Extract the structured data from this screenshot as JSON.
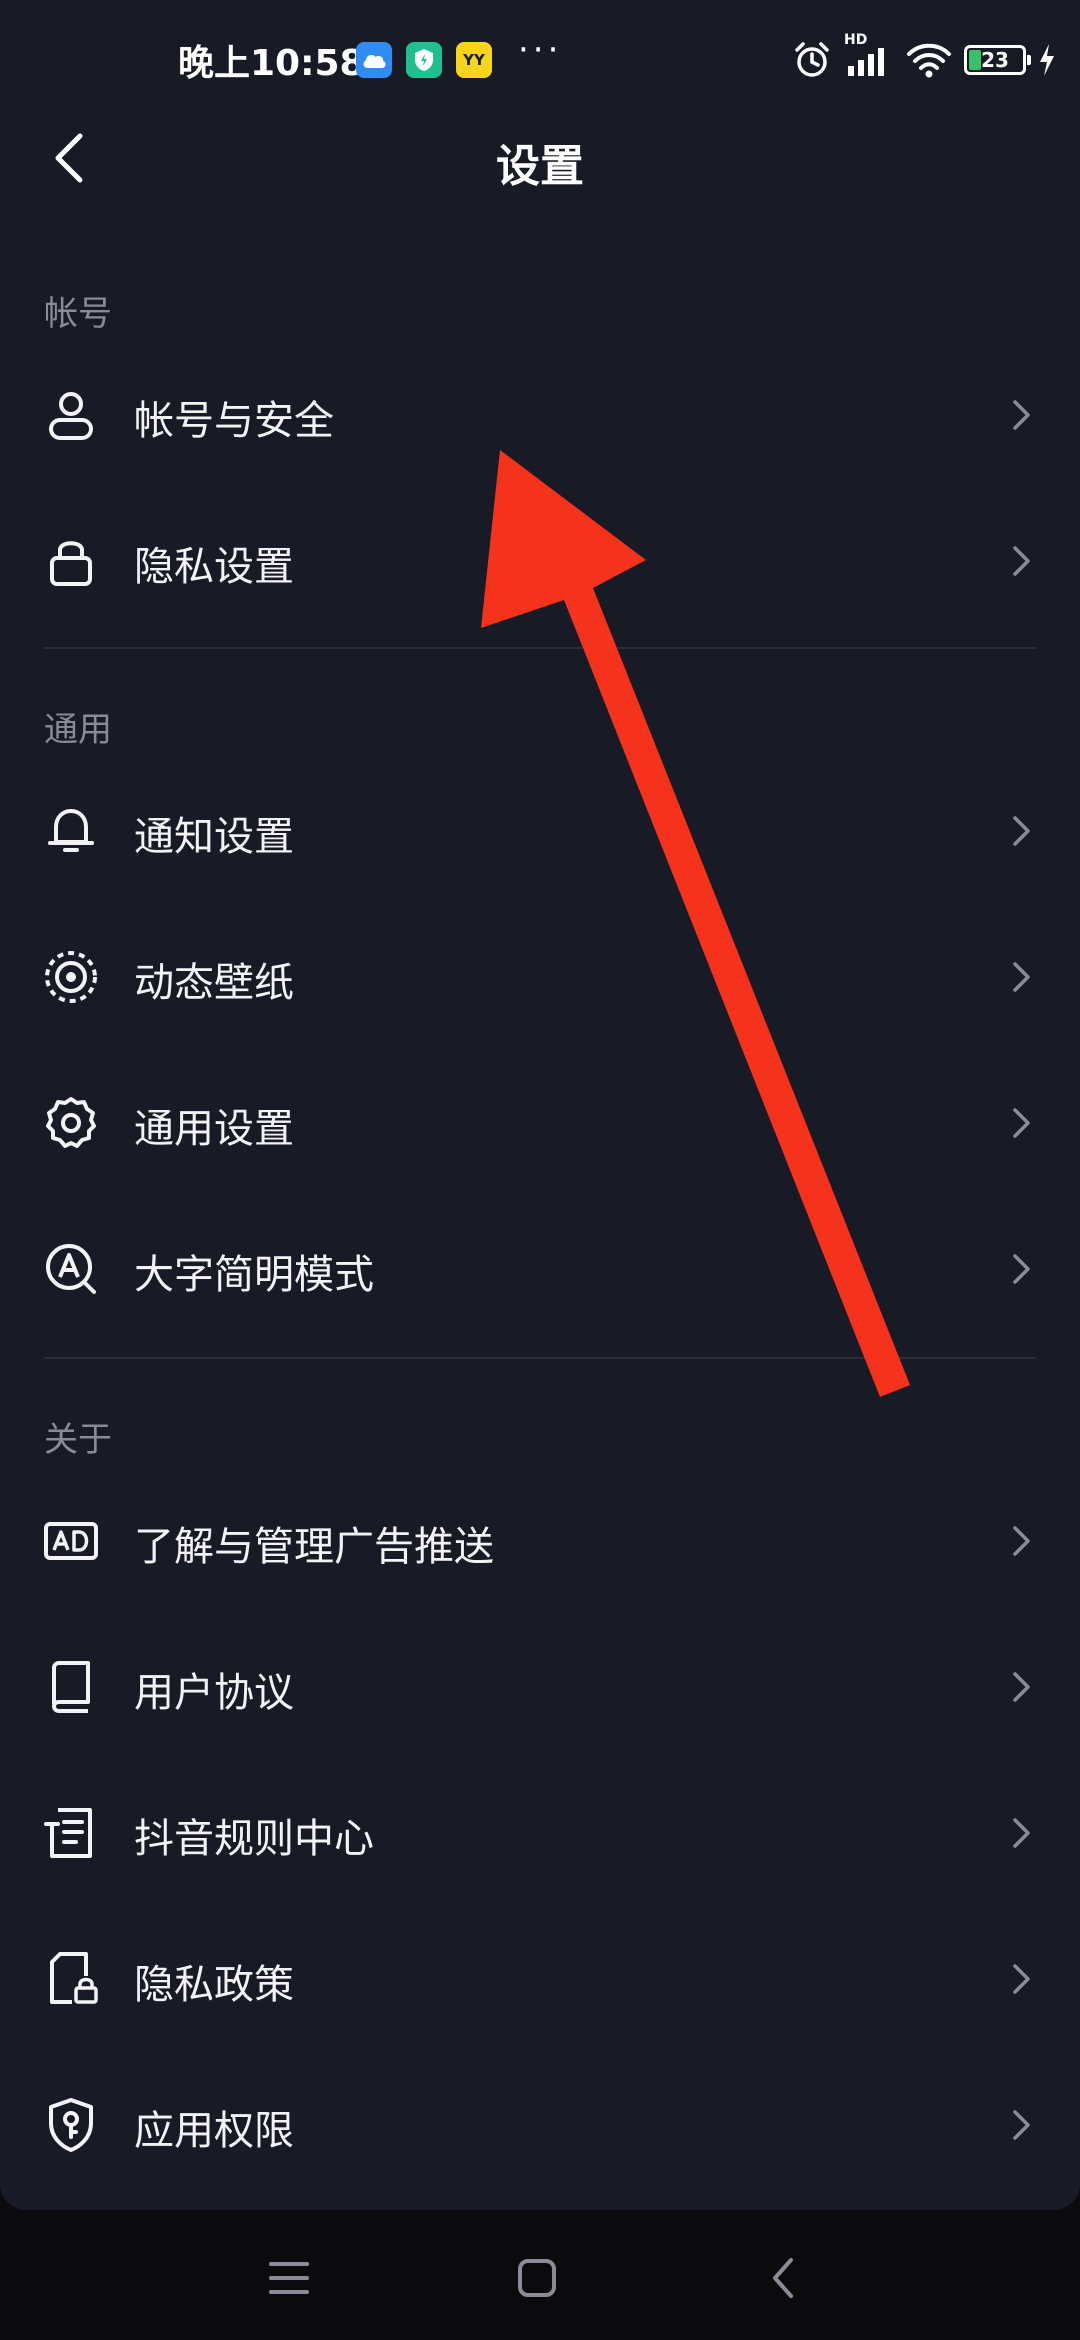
{
  "status_bar": {
    "time": "晚上10:58",
    "more": "···",
    "hd": "HD",
    "battery_level": "23",
    "battery_fraction": 0.23,
    "apps": [
      {
        "icon": "cloud-app-icon",
        "color": "#2f8cf5"
      },
      {
        "icon": "shield-app-icon",
        "color": "#1fbf8f"
      },
      {
        "icon": "yy-app-icon",
        "color": "#f7d51d",
        "text": "YY"
      }
    ]
  },
  "header": {
    "title": "设置"
  },
  "sections": {
    "account": {
      "title": "帐号",
      "items": [
        {
          "label": "帐号与安全",
          "icon": "person-icon"
        },
        {
          "label": "隐私设置",
          "icon": "lock-icon"
        }
      ]
    },
    "general": {
      "title": "通用",
      "items": [
        {
          "label": "通知设置",
          "icon": "bell-icon"
        },
        {
          "label": "动态壁纸",
          "icon": "live-wallpaper-icon"
        },
        {
          "label": "通用设置",
          "icon": "gear-icon"
        },
        {
          "label": "大字简明模式",
          "icon": "large-font-icon"
        }
      ]
    },
    "about": {
      "title": "关于",
      "items": [
        {
          "label": "了解与管理广告推送",
          "icon": "ad-icon"
        },
        {
          "label": "用户协议",
          "icon": "book-icon"
        },
        {
          "label": "抖音规则中心",
          "icon": "document-list-icon"
        },
        {
          "label": "隐私政策",
          "icon": "file-lock-icon"
        },
        {
          "label": "应用权限",
          "icon": "shield-key-icon"
        }
      ]
    }
  },
  "annotation": {
    "arrow_color": "#f5321c",
    "target": "帐号与安全"
  },
  "colors": {
    "background": "#181a26",
    "text": "#f3f3f5",
    "secondary_text": "#8a8b96",
    "divider": "#2b2d39",
    "chevron": "#8a8b96"
  }
}
